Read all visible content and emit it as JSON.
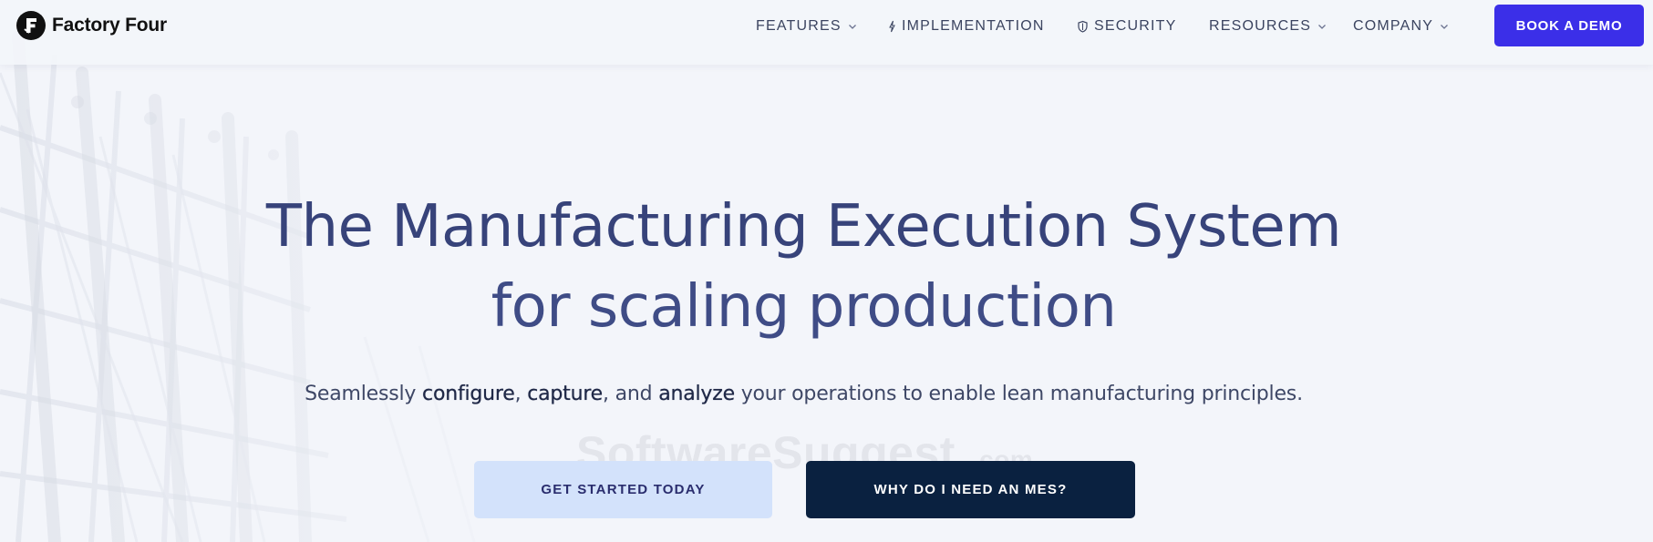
{
  "brand": {
    "name": "Factory Four",
    "logo_icon": "factoryfour-f-logo-icon"
  },
  "nav": {
    "items": [
      {
        "label": "FEATURES",
        "icon": "chevron-down-icon"
      },
      {
        "label": "IMPLEMENTATION",
        "icon": "lightning-icon"
      },
      {
        "label": "SECURITY",
        "icon": "shield-icon"
      },
      {
        "label": "RESOURCES",
        "icon": "chevron-down-icon"
      },
      {
        "label": "COMPANY",
        "icon": "chevron-down-icon"
      }
    ],
    "cta_label": "BOOK A DEMO"
  },
  "hero": {
    "title_line1": "The Manufacturing Execution System",
    "title_line2": "for scaling production",
    "subtitle_parts": [
      {
        "text": "Seamlessly ",
        "bold": false
      },
      {
        "text": "configure",
        "bold": true
      },
      {
        "text": ", ",
        "bold": false
      },
      {
        "text": "capture",
        "bold": true
      },
      {
        "text": ", and ",
        "bold": false
      },
      {
        "text": "analyze",
        "bold": true
      },
      {
        "text": " your operations to enable lean manufacturing principles.",
        "bold": false
      }
    ],
    "primary_button": "GET STARTED TODAY",
    "secondary_button": "WHY DO I NEED AN MES?"
  },
  "watermark": {
    "text": "SoftwareSuggest",
    "suffix": ".com"
  },
  "colors": {
    "background": "#f3f5fa",
    "title": "#37437a",
    "cta_demo": "#3b2fe8",
    "button_primary_bg": "#d3e2fb",
    "button_secondary_bg": "#0a2140"
  }
}
